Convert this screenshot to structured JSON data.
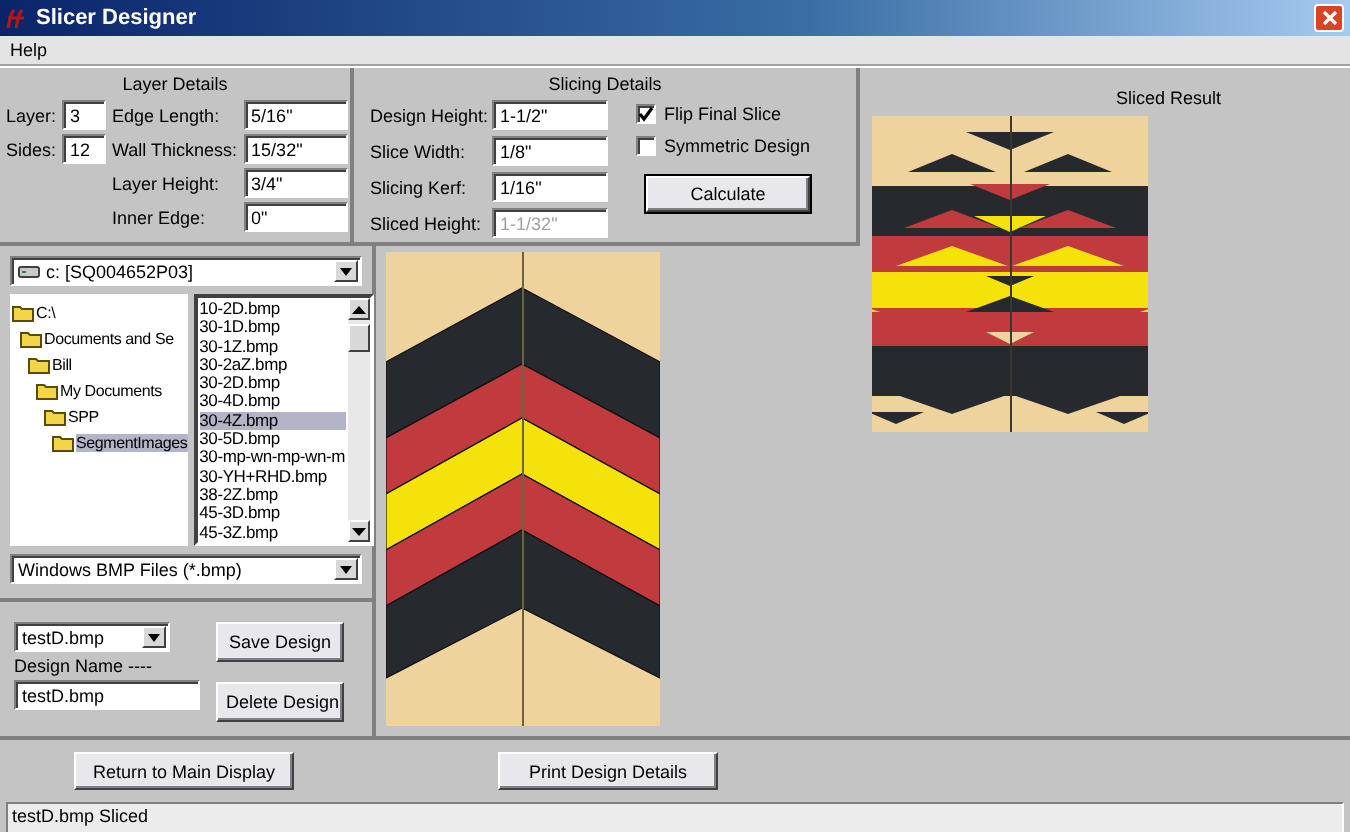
{
  "window": {
    "title": "Slicer Designer"
  },
  "menu": [
    {
      "label": "Help"
    }
  ],
  "layer_details": {
    "title": "Layer Details",
    "small_fields": [
      {
        "label": "Layer:",
        "value": "3"
      },
      {
        "label": "Sides:",
        "value": "12"
      }
    ],
    "fields": [
      {
        "label": "Edge Length:",
        "value": "5/16\""
      },
      {
        "label": "Wall Thickness:",
        "value": "15/32\""
      },
      {
        "label": "Layer Height:",
        "value": "3/4\""
      },
      {
        "label": "Inner Edge:",
        "value": "0\""
      }
    ]
  },
  "slicing_details": {
    "title": "Slicing Details",
    "fields": [
      {
        "label": "Design Height:",
        "value": "1-1/2\"",
        "disabled": false
      },
      {
        "label": "Slice Width:",
        "value": "1/8\"",
        "disabled": false
      },
      {
        "label": "Slicing Kerf:",
        "value": "1/16\"",
        "disabled": false
      },
      {
        "label": "Sliced Height:",
        "value": "1-1/32\"",
        "disabled": true
      }
    ],
    "checkboxes": [
      {
        "label": "Flip Final Slice",
        "checked": true
      },
      {
        "label": "Symmetric Design",
        "checked": false
      }
    ],
    "button": "Calculate"
  },
  "file_browser": {
    "drive": "c: [SQ004652P03]",
    "folders": [
      {
        "label": "C:\\",
        "selected": false,
        "children": [
          {
            "label": "Documents and Se",
            "selected": false,
            "children": [
              {
                "label": "Bill",
                "selected": false,
                "children": [
                  {
                    "label": "My Documents",
                    "selected": false,
                    "children": [
                      {
                        "label": "SPP",
                        "selected": false,
                        "children": [
                          {
                            "label": "SegmentImages",
                            "selected": true
                          }
                        ]
                      }
                    ]
                  }
                ]
              }
            ]
          }
        ]
      }
    ],
    "files": [
      {
        "label": "10-2D.bmp",
        "selected": false
      },
      {
        "label": "30-1D.bmp",
        "selected": false
      },
      {
        "label": "30-1Z.bmp",
        "selected": false
      },
      {
        "label": "30-2aZ.bmp",
        "selected": false
      },
      {
        "label": "30-2D.bmp",
        "selected": false
      },
      {
        "label": "30-4D.bmp",
        "selected": false
      },
      {
        "label": "30-4Z.bmp",
        "selected": true
      },
      {
        "label": "30-5D.bmp",
        "selected": false
      },
      {
        "label": "30-mp-wn-mp-wn-m",
        "selected": false
      },
      {
        "label": "30-YH+RHD.bmp",
        "selected": false
      },
      {
        "label": "38-2Z.bmp",
        "selected": false
      },
      {
        "label": "45-3D.bmp",
        "selected": false
      },
      {
        "label": "45-3Z.bmp",
        "selected": false
      }
    ],
    "filter": "Windows BMP Files (*.bmp)"
  },
  "design": {
    "selected_file": "testD.bmp",
    "name_label": "Design Name ----",
    "name_value": "testD.bmp",
    "buttons": [
      "Save Design",
      "Delete Design"
    ]
  },
  "sliced_result": {
    "title": "Sliced Result"
  },
  "buttons": [
    "Return to Main Display",
    "Print Design Details"
  ],
  "status_bar": "testD.bmp Sliced"
}
